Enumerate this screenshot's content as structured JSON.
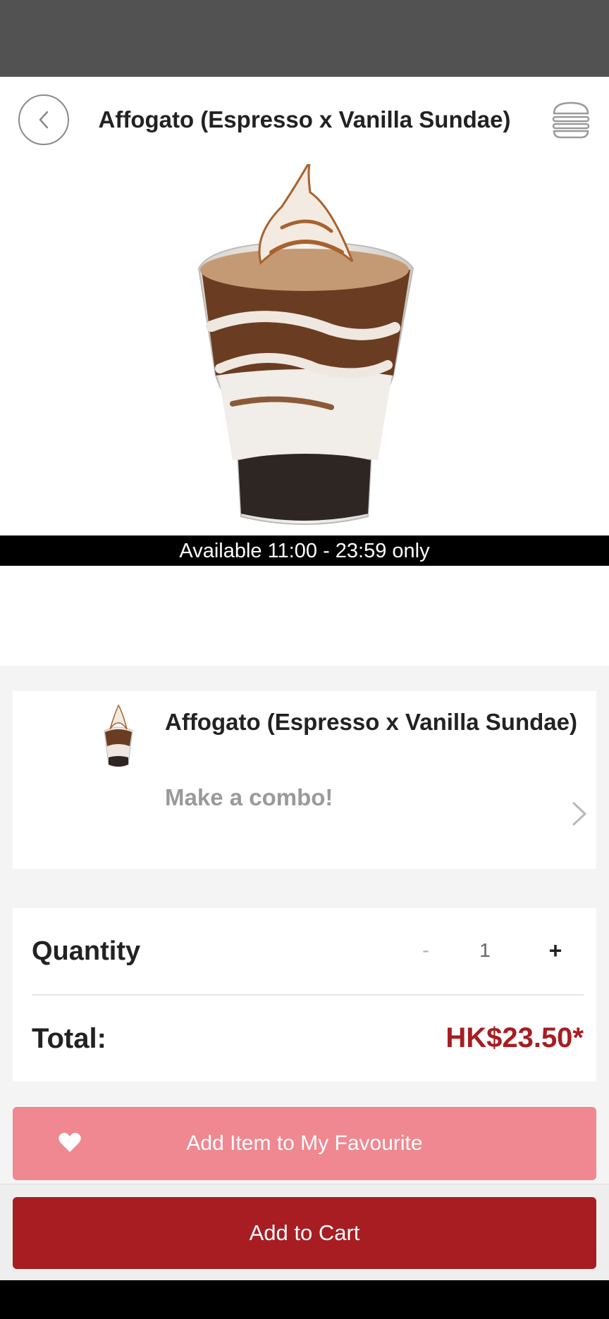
{
  "header": {
    "title": "Affogato (Espresso x Vanilla Sundae)"
  },
  "product": {
    "availability": "Available 11:00 - 23:59 only",
    "name": "Affogato (Espresso x Vanilla Sundae)",
    "combo_label": "Make a combo!"
  },
  "order": {
    "quantity_label": "Quantity",
    "minus_label": "-",
    "quantity": "1",
    "plus_label": "+",
    "total_label": "Total:",
    "total_value": "HK$23.50*"
  },
  "actions": {
    "favourite_label": "Add Item to My Favourite",
    "cart_label": "Add to Cart"
  },
  "colors": {
    "brand_red": "#a71d22",
    "favourite_pink": "#ef8890"
  },
  "icons": {
    "back": "chevron-left-icon",
    "menu": "burger-menu-icon",
    "combo": "chevron-right-icon",
    "favourite": "heart-icon"
  }
}
